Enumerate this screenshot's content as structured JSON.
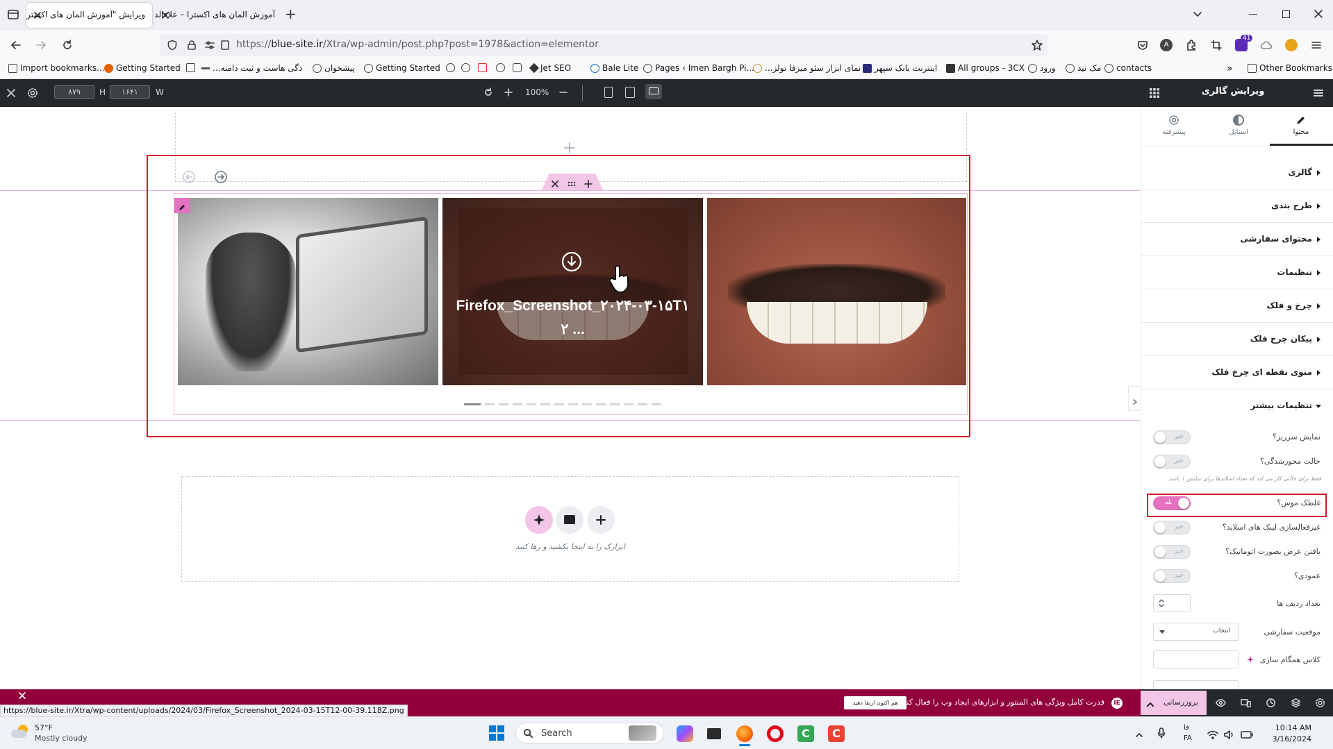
{
  "browser": {
    "tabs": [
      {
        "title": "ویرایش \"آموزش المان های اکسترا – ع",
        "active": true
      },
      {
        "title": "آموزش المان های اکسترا – علاءالدین",
        "active": false
      }
    ],
    "new_tab": "+",
    "url_prefix": "https://",
    "url_domain": "blue-site.ir",
    "url_path": "/Xtra/wp-admin/post.php?post=1978&action=elementor",
    "extension_badge": "41",
    "bookmarks": [
      "Import bookmarks...",
      "Getting Started",
      "...دگی هاست و ثبت دامنه",
      "پیشخوان",
      "Getting Started",
      "Jet SEO",
      "Bale Lite",
      "Pages ‹ Imen Bargh Pi...",
      "...نمای ابزار سئو میزفا تولز",
      "اینترنت بانک سپهر",
      "All groups - 3CX",
      "ورود",
      "مک نید",
      "contacts"
    ],
    "other_bookmarks": "Other Bookmarks"
  },
  "editor_top": {
    "height_label": "H",
    "height_value": "۸۷۹",
    "width_label": "W",
    "width_value": "۱۶۴۱",
    "zoom": "100%"
  },
  "canvas": {
    "gallery_caption_line1": "Firefox_Screenshot_۲۰۲۴-۰۳-۱۵T۱",
    "gallery_caption_line2": "۲ ...",
    "dropzone_text": "ابزارک را به اینجا بکشید و رها کنید"
  },
  "panel": {
    "title": "ویرایش گالری",
    "tabs": [
      "محتوا",
      "استایل",
      "پیشرفته"
    ],
    "sections": [
      "گالری",
      "طرح بندی",
      "محتوای سفارشی",
      "تنظیمات",
      "چرخ و فلک",
      "پیکان چرخ فلک",
      "منوی نقطه ای چرخ فلک"
    ],
    "open_section": "تنظیمات بیشتر",
    "toggles": [
      {
        "label": "نمایش سرریز؟",
        "value": "خیر",
        "on": false
      },
      {
        "label": "حالت محورشدگی؟",
        "value": "خیر",
        "on": false
      },
      {
        "label": "غلطک موس؟",
        "value": "بله",
        "on": true
      },
      {
        "label": "غیرفعالسازی لینک های اسلاید؟",
        "value": "خیر",
        "on": false
      },
      {
        "label": "یافتن عرض بصورت اتوماتیک؟",
        "value": "خیر",
        "on": false
      },
      {
        "label": "عمودی؟",
        "value": "خیر",
        "on": false
      }
    ],
    "hint": "فقط برای حالتی کار می کند که تعداد اسلایدها برای نمایش ۱ باشد.",
    "rows_label": "تعداد ردیف ها",
    "position_label": "موقعیت سفارشی",
    "position_value": "انتخاب",
    "sync_label": "کلاس همگام سازی",
    "update_button": "بروزرسانی"
  },
  "notice": {
    "text": "قدرت کامل ویژگی های المنتور و ابزارهای ایجاد وب را فعال کنید.",
    "button": "هم اکنون ارتقا دهید"
  },
  "status_url": "https://blue-site.ir/Xtra/wp-content/uploads/2024/03/Firefox_Screenshot_2024-03-15T12-00-39.118Z.png",
  "taskbar": {
    "temperature": "57°F",
    "weather": "Mostly cloudy",
    "search": "Search",
    "lang_top": "فا",
    "lang_bottom": "FA",
    "time": "10:14 AM",
    "date": "3/16/2024"
  },
  "colors": {
    "accent": "#e472c1",
    "highlight": "#d7182a",
    "notice_bg": "#92003b",
    "editor_dark": "#26292c"
  }
}
